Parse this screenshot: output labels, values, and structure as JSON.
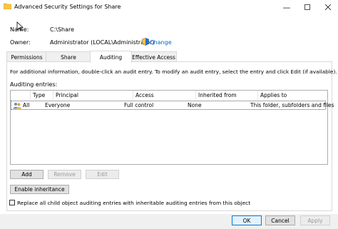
{
  "window": {
    "title": "Advanced Security Settings for Share",
    "minimize_icon": "minimize-icon",
    "maximize_icon": "maximize-icon",
    "close_icon": "close-icon"
  },
  "info": {
    "name_label": "Name:",
    "name_value": "C:\\Share",
    "owner_label": "Owner:",
    "owner_value": "Administrator (LOCAL\\Administrator)",
    "change_label": "Change"
  },
  "tabs": [
    {
      "label": "Permissions"
    },
    {
      "label": "Share"
    },
    {
      "label": "Auditing",
      "active": true
    },
    {
      "label": "Effective Access"
    }
  ],
  "panel": {
    "instructions": "For additional information, double-click an audit entry. To modify an audit entry, select the entry and click Edit (if available).",
    "entries_label": "Auditing entries:",
    "columns": [
      "Type",
      "Principal",
      "Access",
      "Inherited from",
      "Applies to"
    ],
    "rows": [
      {
        "type": "All",
        "principal": "Everyone",
        "access": "Full control",
        "inherited_from": "None",
        "applies_to": "This folder, subfolders and files"
      }
    ],
    "add_label": "Add",
    "remove_label": "Remove",
    "edit_label": "Edit",
    "enable_inheritance_label": "Enable inheritance",
    "replace_checkbox_label": "Replace all child object auditing entries with inheritable auditing entries from this object",
    "replace_checked": false
  },
  "footer": {
    "ok_label": "OK",
    "cancel_label": "Cancel",
    "apply_label": "Apply"
  },
  "colors": {
    "accent": "#0078d7",
    "link": "#0066cc",
    "folder": "#f5c542"
  }
}
